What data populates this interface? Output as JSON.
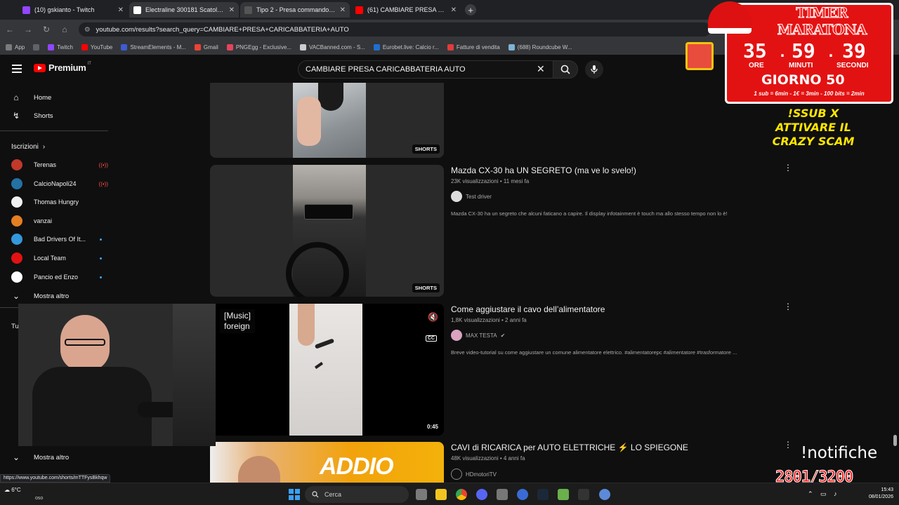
{
  "browser": {
    "tabs": [
      {
        "title": "(10) gskianto - Twitch",
        "color": "#9146ff"
      },
      {
        "title": "Electraline 300181 Scatola di Pi",
        "color": "#ffffff"
      },
      {
        "title": "Tipo 2 - Presa commando rossa",
        "color": "#555555"
      },
      {
        "title": "(61) CAMBIARE PRESA CARICAB",
        "color": "#ff0000"
      }
    ],
    "new_tab": "+",
    "url": "youtube.com/results?search_query=CAMBIARE+PRESA+CARICABBATERIA+AUTO",
    "bookmarks": [
      {
        "label": "App",
        "color": "#7b7b7b"
      },
      {
        "label": "Twitch",
        "color": "#9146ff"
      },
      {
        "label": "YouTube",
        "color": "#ff0000"
      },
      {
        "label": "StreamElements - M...",
        "color": "#3c5cd1"
      },
      {
        "label": "Gmail",
        "color": "#ea4335"
      },
      {
        "label": "PNGEgg - Exclusive...",
        "color": "#e4445c"
      },
      {
        "label": "VACBanned.com - S...",
        "color": "#cccccc"
      },
      {
        "label": "Eurobet.live: Calcio r...",
        "color": "#1f6fd1"
      },
      {
        "label": "Fatture di vendita",
        "color": "#e23b3b"
      },
      {
        "label": "(688) Roundcube W...",
        "color": "#7fb3d5"
      }
    ]
  },
  "youtube": {
    "logo_text": "Premium",
    "logo_country": "IT",
    "search_query": "CAMBIARE PRESA CARICABBATERIA AUTO",
    "nav": [
      {
        "label": "Home",
        "icon": "home-icon"
      },
      {
        "label": "Shorts",
        "icon": "shorts-icon"
      }
    ],
    "subscriptions_title": "Iscrizioni",
    "subscriptions": [
      {
        "name": "Terenas",
        "status": "live",
        "color": "#c0392b"
      },
      {
        "name": "CalcioNapoli24",
        "status": "live",
        "color": "#2471a3"
      },
      {
        "name": "Thomas Hungry",
        "status": "",
        "color": "#f1f1f1"
      },
      {
        "name": "vanzai",
        "status": "",
        "color": "#e67e22"
      },
      {
        "name": "Bad Drivers Of It...",
        "status": "new",
        "color": "#3498db"
      },
      {
        "name": "Local Team",
        "status": "new",
        "color": "#e31212"
      },
      {
        "name": "Pancio ed Enzo",
        "status": "new",
        "color": "#ffffff"
      }
    ],
    "show_more": "Mostra altro",
    "section_2_partial": "Tu",
    "show_more_2": "Mostra altro",
    "results": [
      {
        "title": "",
        "badge": "SHORTS"
      },
      {
        "title": "Mazda CX-30 ha UN SEGRETO (ma ve lo svelo!)",
        "meta": "23K visualizzazioni • 11 mesi fa",
        "channel": "Test driver",
        "verified": false,
        "description": "Mazda CX-30 ha un segreto che alcuni faticano a capire. Il display infotainment è touch ma allo stesso tempo non lo è!",
        "badge": "SHORTS"
      },
      {
        "title": "Come aggiustare il cavo dell’alimentatore",
        "meta": "1,8K visualizzazioni • 2 anni fa",
        "channel": "MAX TESTA",
        "verified": true,
        "description": "Breve video-tutorial su come aggiustare un comune alimentatore elettrico. #alimentatorepc #alimentatore #trasformatore ...",
        "duration": "0:45",
        "caption": "[Music]\nforeign",
        "cc": "CC"
      },
      {
        "title": "CAVI di RICARICA per AUTO ELETTRICHE ⚡ LO SPIEGONE",
        "meta": "48K visualizzazioni • 4 anni fa",
        "channel": "HDmotoriTV",
        "thumb_text": "ADDIO"
      }
    ]
  },
  "overlay": {
    "timer_title": "TIMER MARATONA",
    "hours": "35",
    "minutes": "59",
    "seconds": "39",
    "hours_label": "ORE",
    "minutes_label": "MINUTI",
    "seconds_label": "SECONDI",
    "day": "GIORNO 50",
    "rates": "1 sub = 6min - 1€ = 3min - 100 bits = 2min",
    "sub_command": "!SSUB X ATTIVARE IL CRAZY SCAM",
    "notif_command": "!notifiche",
    "counter": "2801/3200"
  },
  "status_url": "https://www.youtube.com/shorts/mTTFysBkhqw",
  "taskbar": {
    "weather_temp": "6°C",
    "weather_text": "oso",
    "search_label": "Cerca",
    "time": "15:43",
    "date": "08/01/2026"
  }
}
